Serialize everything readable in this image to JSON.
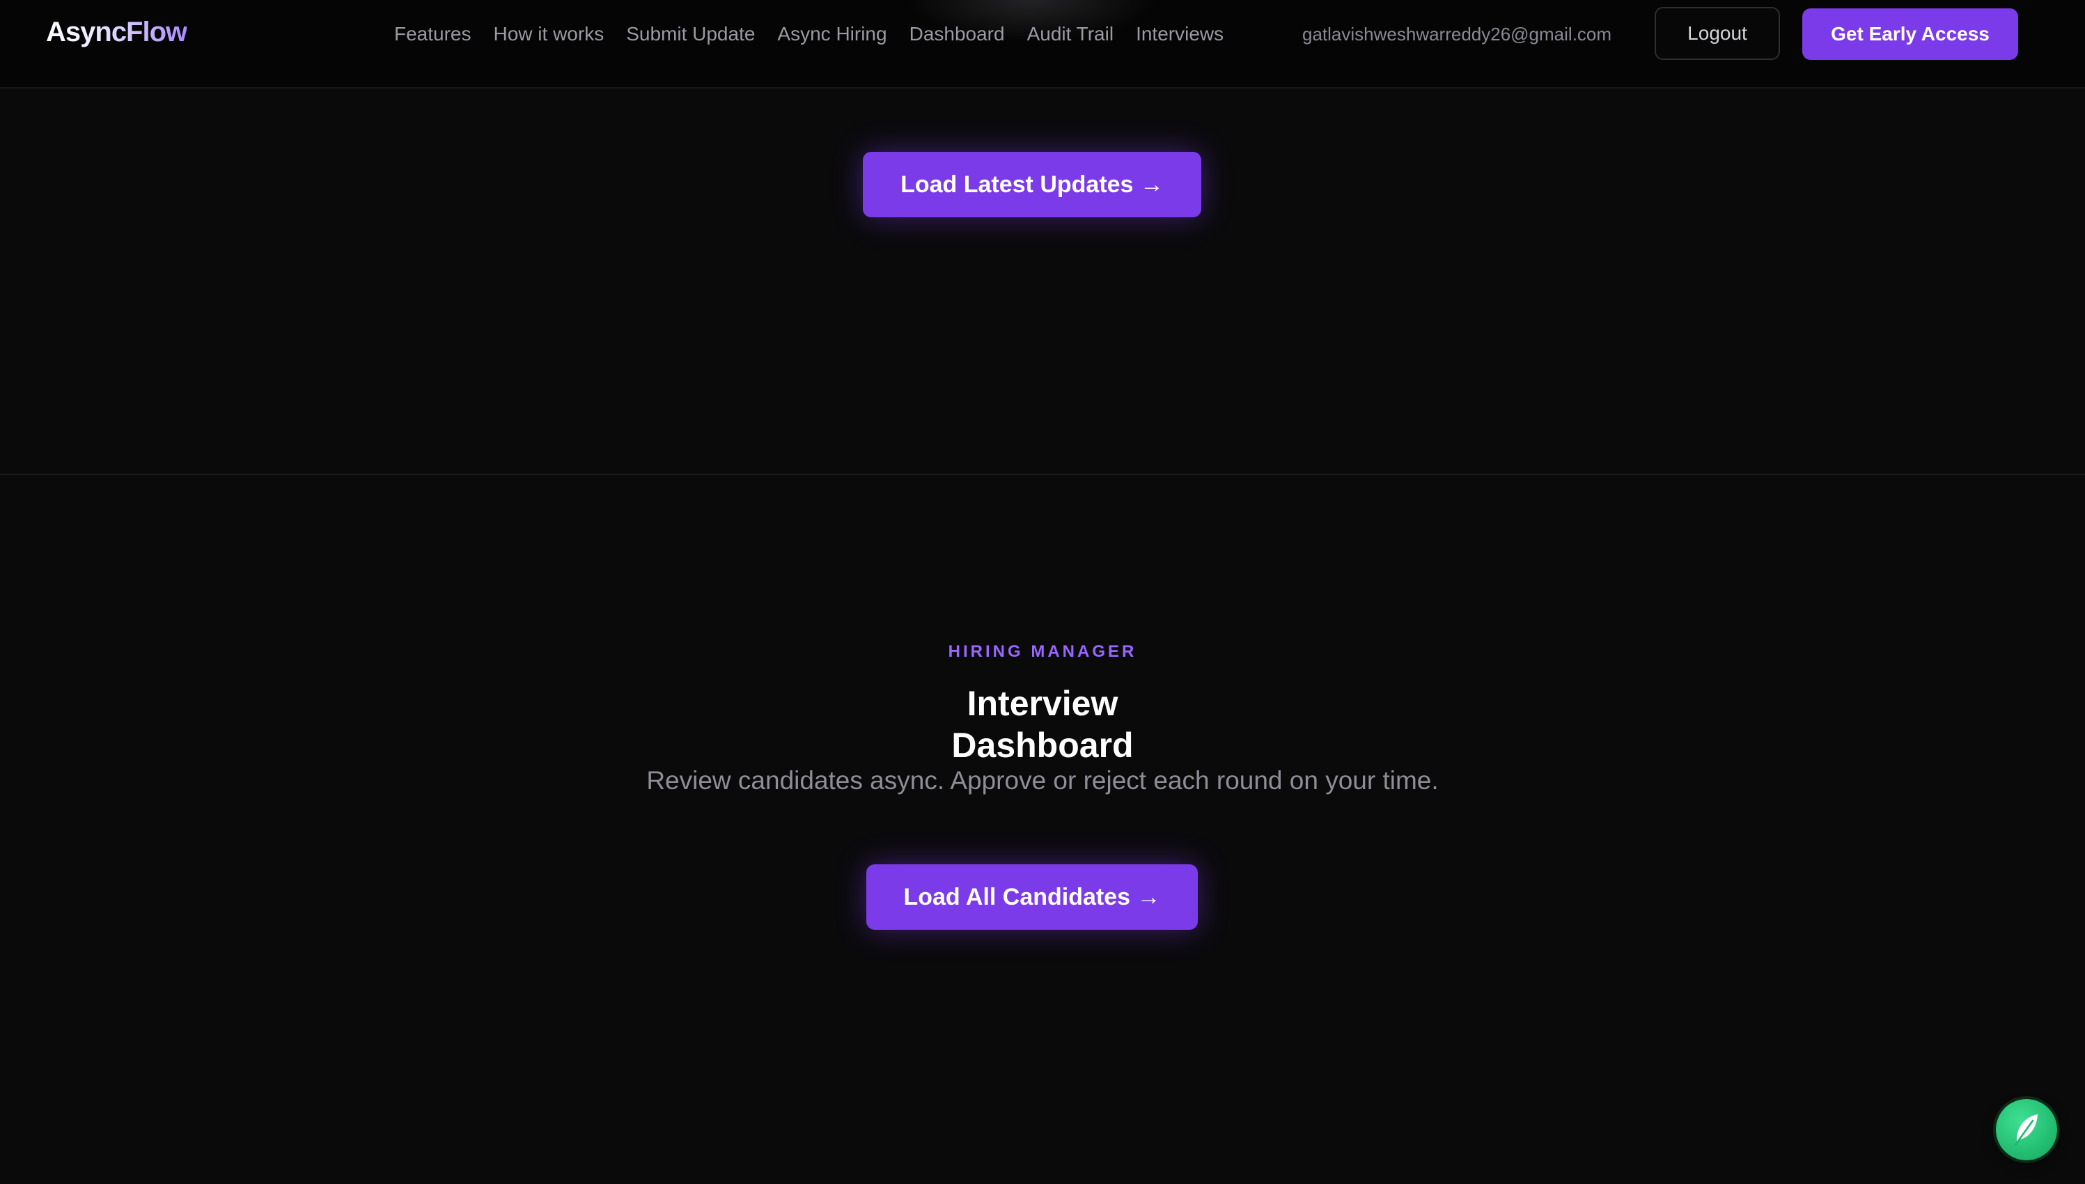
{
  "brand": {
    "logo": "AsyncFlow",
    "accent": "#7b3be8",
    "eyebrow_color": "#9a66ff"
  },
  "nav": {
    "links": [
      "Features",
      "How it works",
      "Submit Update",
      "Async Hiring",
      "Dashboard",
      "Audit Trail",
      "Interviews"
    ],
    "user_email": "gatlavishweshwarreddy26@gmail.com",
    "logout_label": "Logout",
    "cta_label": "Get Early Access"
  },
  "updates_section": {
    "button_label": "Load Latest Updates →"
  },
  "hiring_section": {
    "eyebrow": "HIRING MANAGER",
    "title": "Interview Dashboard",
    "subtitle": "Review candidates async. Approve or reject each round on your time.",
    "button_label": "Load All Candidates →"
  },
  "fab": {
    "icon": "feather-icon",
    "color": "#22c55e"
  }
}
